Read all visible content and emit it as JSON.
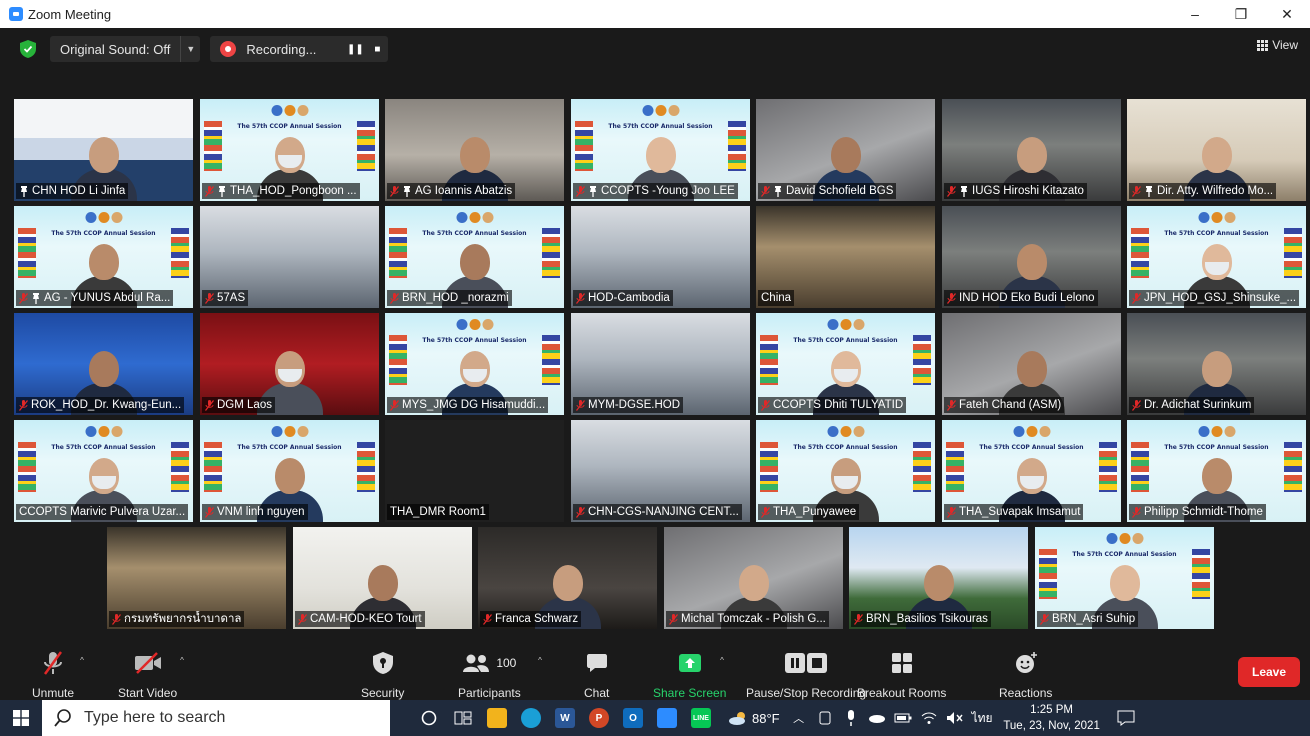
{
  "window": {
    "title": "Zoom Meeting",
    "minimize": "–",
    "restore": "❐",
    "close": "✕"
  },
  "topbar": {
    "original_sound": "Original Sound: Off",
    "recording": "Recording...",
    "view": "View"
  },
  "participants": [
    {
      "name": "CHN HOD Li Jinfa",
      "muted": false,
      "pinned": true,
      "bg": "chn",
      "masked": false
    },
    {
      "name": "THA_HOD_Pongboon ...",
      "muted": true,
      "pinned": true,
      "bg": "banner",
      "masked": true
    },
    {
      "name": "AG Ioannis Abatzis",
      "muted": true,
      "pinned": true,
      "bg": "office",
      "masked": false
    },
    {
      "name": "CCOPTS -Young Joo LEE",
      "muted": true,
      "pinned": true,
      "bg": "banner",
      "masked": false
    },
    {
      "name": "David Schofield BGS",
      "muted": true,
      "pinned": true,
      "bg": "grey",
      "masked": false
    },
    {
      "name": "IUGS Hiroshi Kitazato",
      "muted": true,
      "pinned": true,
      "bg": "office2",
      "masked": false
    },
    {
      "name": "Dir. Atty. Wilfredo Mo...",
      "muted": true,
      "pinned": true,
      "bg": "room",
      "masked": false
    },
    {
      "name": "AG - YUNUS Abdul Ra...",
      "muted": true,
      "pinned": true,
      "bg": "banner",
      "masked": false
    },
    {
      "name": "57AS",
      "muted": true,
      "pinned": false,
      "bg": "hall",
      "masked": false
    },
    {
      "name": "BRN_HOD _norazmi",
      "muted": true,
      "pinned": false,
      "bg": "banner",
      "masked": false
    },
    {
      "name": "HOD-Cambodia",
      "muted": true,
      "pinned": false,
      "bg": "hall",
      "masked": false
    },
    {
      "name": "China",
      "muted": false,
      "pinned": false,
      "bg": "hall2",
      "masked": false,
      "active": true
    },
    {
      "name": "IND HOD Eko Budi Lelono",
      "muted": true,
      "pinned": false,
      "bg": "office2",
      "masked": false
    },
    {
      "name": "JPN_HOD_GSJ_Shinsuke_...",
      "muted": true,
      "pinned": false,
      "bg": "banner",
      "masked": true
    },
    {
      "name": "ROK_HOD_Dr. Kwang-Eun...",
      "muted": true,
      "pinned": false,
      "bg": "kor",
      "masked": false
    },
    {
      "name": "DGM Laos",
      "muted": true,
      "pinned": false,
      "bg": "red",
      "masked": true
    },
    {
      "name": "MYS_JMG DG Hisamuddi...",
      "muted": true,
      "pinned": false,
      "bg": "banner",
      "masked": true
    },
    {
      "name": "MYM-DGSE.HOD",
      "muted": true,
      "pinned": false,
      "bg": "hall",
      "masked": false
    },
    {
      "name": "CCOPTS Dhiti TULYATID",
      "muted": true,
      "pinned": false,
      "bg": "banner",
      "masked": true
    },
    {
      "name": "Fateh Chand (ASM)",
      "muted": true,
      "pinned": false,
      "bg": "grey",
      "masked": false
    },
    {
      "name": "Dr. Adichat Surinkum",
      "muted": true,
      "pinned": false,
      "bg": "office2",
      "masked": false
    },
    {
      "name": "CCOPTS Marivic Pulvera Uzar...",
      "muted": false,
      "pinned": false,
      "bg": "banner",
      "masked": true
    },
    {
      "name": "VNM linh nguyen",
      "muted": true,
      "pinned": false,
      "bg": "banner",
      "masked": false
    },
    {
      "name": "THA_DMR Room1",
      "muted": false,
      "pinned": false,
      "bg": "empty",
      "masked": false
    },
    {
      "name": "CHN-CGS-NANJING CENT...",
      "muted": true,
      "pinned": false,
      "bg": "hall",
      "masked": true
    },
    {
      "name": "THA_Punyawee",
      "muted": true,
      "pinned": false,
      "bg": "banner",
      "masked": true
    },
    {
      "name": "THA_Suvapak Imsamut",
      "muted": true,
      "pinned": false,
      "bg": "banner",
      "masked": true
    },
    {
      "name": "Philipp Schmidt-Thome",
      "muted": true,
      "pinned": false,
      "bg": "banner",
      "masked": false
    },
    {
      "name": "กรมทรัพยากรน้ำบาดาล",
      "muted": true,
      "pinned": false,
      "bg": "hall2",
      "masked": false
    },
    {
      "name": "CAM-HOD-KEO Tourt",
      "muted": true,
      "pinned": false,
      "bg": "light",
      "masked": false
    },
    {
      "name": "Franca Schwarz",
      "muted": true,
      "pinned": false,
      "bg": "dark",
      "masked": false
    },
    {
      "name": "Michal Tomczak - Polish G...",
      "muted": true,
      "pinned": false,
      "bg": "grey",
      "masked": false
    },
    {
      "name": "BRN_Basilios Tsikouras",
      "muted": true,
      "pinned": false,
      "bg": "campus",
      "masked": false
    },
    {
      "name": "BRN_Asri Suhip",
      "muted": true,
      "pinned": false,
      "bg": "banner",
      "masked": false
    }
  ],
  "banner": {
    "line1": "The 57th CCOP Annual Session",
    "line2": "The 77th CCOP Steering Committee Meeting"
  },
  "controls": {
    "unmute": "Unmute",
    "start_video": "Start Video",
    "security": "Security",
    "participants": "Participants",
    "participants_count": "100",
    "chat": "Chat",
    "share_screen": "Share Screen",
    "pause_stop_recording": "Pause/Stop Recording",
    "breakout_rooms": "Breakout Rooms",
    "reactions": "Reactions",
    "leave": "Leave"
  },
  "taskbar": {
    "search_placeholder": "Type here to search",
    "weather": "88°F",
    "language": "ไทย",
    "time": "1:25 PM",
    "date": "Tue, 23, Nov, 2021"
  },
  "colors": {
    "accent_green": "#27d36b",
    "leave_red": "#e02828",
    "active_speaker": "#c8e06a",
    "taskbar": "#1f2a3c"
  }
}
